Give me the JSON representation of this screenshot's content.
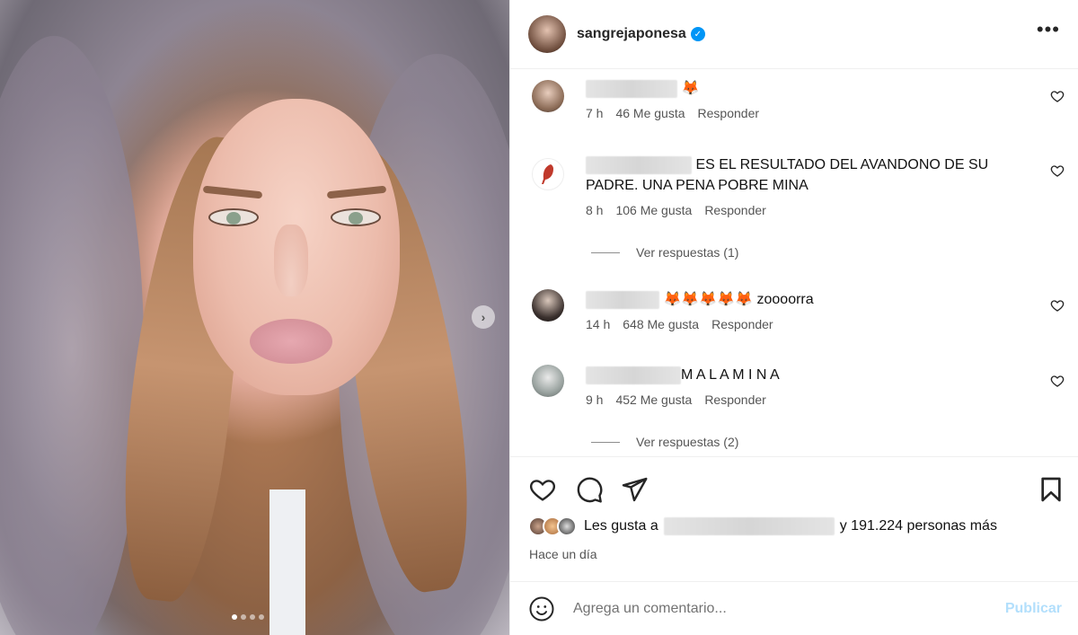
{
  "post": {
    "username": "sangrejaponesa",
    "verified": true,
    "more_icon": "more-horizontal-icon",
    "carousel": {
      "current": 1,
      "total": 4
    }
  },
  "comments": [
    {
      "text": "🦊",
      "time": "7 h",
      "likes": "46 Me gusta",
      "reply": "Responder",
      "username_hidden": true
    },
    {
      "text": "ES EL RESULTADO DEL AVANDONO DE SU PADRE. UNA PENA POBRE MINA",
      "time": "8 h",
      "likes": "106 Me gusta",
      "reply": "Responder",
      "username_hidden": true,
      "view_replies": "Ver respuestas (1)"
    },
    {
      "text": "🦊🦊🦊🦊🦊 zoooorra",
      "time": "14 h",
      "likes": "648 Me gusta",
      "reply": "Responder",
      "username_hidden": true
    },
    {
      "text": "M A L A M I N A",
      "time": "9 h",
      "likes": "452 Me gusta",
      "reply": "Responder",
      "username_hidden": true,
      "view_replies": "Ver respuestas (2)"
    }
  ],
  "actions": {
    "like_icon": "heart-icon",
    "comment_icon": "comment-icon",
    "share_icon": "send-icon",
    "save_icon": "bookmark-icon"
  },
  "likes_summary": {
    "prefix": "Les gusta a",
    "suffix": "y 191.224 personas más"
  },
  "time_ago": "Hace un día",
  "add_comment": {
    "placeholder": "Agrega un comentario...",
    "publish": "Publicar",
    "emoji_icon": "smiley-icon"
  },
  "colors": {
    "verified": "#0095f6",
    "publish_disabled": "#b2dffc",
    "text": "#262626",
    "muted": "#737373"
  }
}
